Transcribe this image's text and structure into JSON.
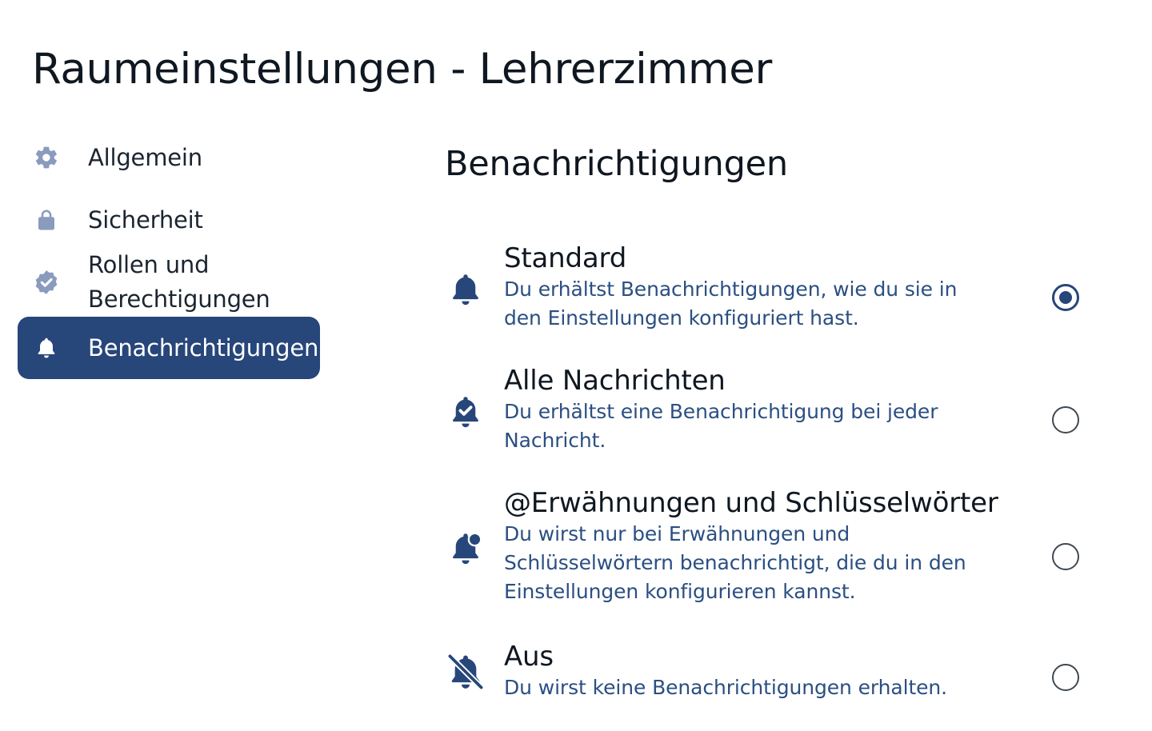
{
  "page": {
    "title": "Raumeinstellungen - Lehrerzimmer"
  },
  "sidebar": {
    "items": [
      {
        "label": "Allgemein",
        "icon": "gear-icon",
        "active": false
      },
      {
        "label": "Sicherheit",
        "icon": "lock-icon",
        "active": false
      },
      {
        "label": "Rollen und Berechtigungen",
        "icon": "verified-badge-icon",
        "active": false
      },
      {
        "label": "Benachrichtigungen",
        "icon": "bell-icon",
        "active": true
      }
    ]
  },
  "main": {
    "section_title": "Benachrichtigungen",
    "options": [
      {
        "title": "Standard",
        "description": "Du erhältst Benachrichtigungen, wie du sie in den Einstellungen konfiguriert hast.",
        "icon": "bell-icon",
        "selected": true
      },
      {
        "title": "Alle Nachrichten",
        "description": "Du erhältst eine Benachrichtigung bei jeder Nachricht.",
        "icon": "bell-check-icon",
        "selected": false
      },
      {
        "title": "@Erwähnungen und Schlüsselwörter",
        "description": "Du wirst nur bei Erwähnungen und Schlüsselwörtern benachrichtigt, die du in den Einstellungen konfigurieren kannst.",
        "icon": "bell-dot-icon",
        "selected": false
      },
      {
        "title": "Aus",
        "description": "Du wirst keine Benachrichtigungen erhalten.",
        "icon": "bell-off-icon",
        "selected": false
      }
    ]
  },
  "colors": {
    "accent": "#27467a",
    "description_text": "#2b4f82",
    "sidebar_icon": "#8a9bbd"
  }
}
